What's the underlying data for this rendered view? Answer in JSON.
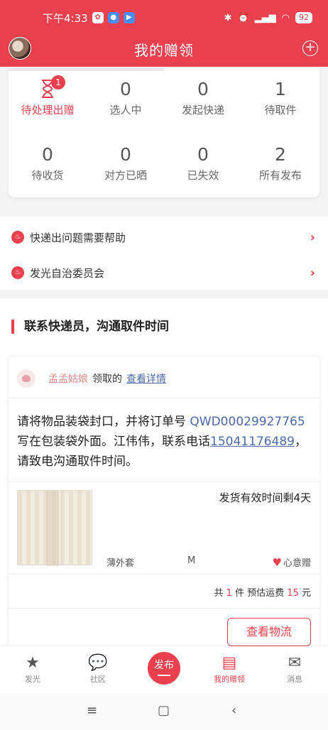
{
  "status_bar": {
    "time": "下午4:33",
    "battery": "92"
  },
  "header": {
    "title": "我的赠领"
  },
  "stats": [
    {
      "count": "",
      "label": "待处理出赠",
      "badge": "1"
    },
    {
      "count": "0",
      "label": "选人中"
    },
    {
      "count": "0",
      "label": "发起快递"
    },
    {
      "count": "1",
      "label": "待取件"
    },
    {
      "count": "0",
      "label": "待收货"
    },
    {
      "count": "0",
      "label": "对方已晒"
    },
    {
      "count": "0",
      "label": "已失效"
    },
    {
      "count": "2",
      "label": "所有发布"
    }
  ],
  "links": [
    {
      "label": "快递出问题需要帮助"
    },
    {
      "label": "发光自治委员会"
    }
  ],
  "section_title": "联系快递员，沟通取件时间",
  "order": {
    "claimer_name": "孟孟姑娘",
    "claim_verb": "领取的",
    "detail_link": "查看详情",
    "instr_1": "请将物品装袋封口，并将订单号 ",
    "order_no": "QWD00029927765",
    "instr_2": " 写在包装袋外面。江伟伟，联系电话",
    "phone": "15041176489",
    "instr_3": "，请致电沟通取件时间。",
    "remaining": "发货有效时间剩4天",
    "goods_name": "薄外套",
    "goods_size": "M",
    "gift_tag": "心意赠",
    "total_prefix": "共",
    "qty": "1",
    "total_mid": "件 预估运费",
    "shipping": "15",
    "total_unit": "元",
    "logistics_button": "查看物流"
  },
  "tabs": [
    {
      "label": "发光",
      "icon": "star-icon"
    },
    {
      "label": "社区",
      "icon": "chat-icon"
    },
    {
      "label": "发布",
      "icon": "publish-icon"
    },
    {
      "label": "我的赠领",
      "icon": "gift-box-icon",
      "active": true
    },
    {
      "label": "消息",
      "icon": "mail-icon"
    }
  ],
  "colors": {
    "accent": "#e8404e",
    "link": "#4a6aa8"
  }
}
